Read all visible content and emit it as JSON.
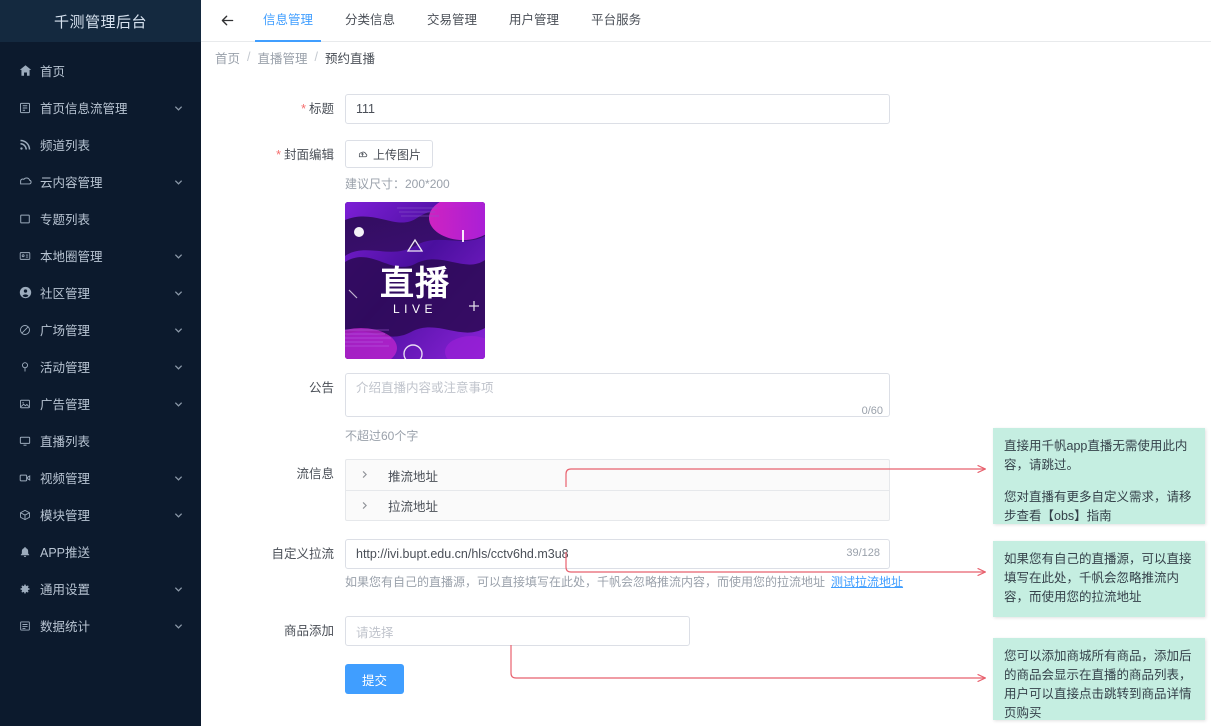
{
  "sidebar": {
    "brand": "千测管理后台",
    "items": [
      {
        "label": "首页",
        "icon": "home-icon",
        "expandable": false
      },
      {
        "label": "首页信息流管理",
        "icon": "feed-icon",
        "expandable": true
      },
      {
        "label": "频道列表",
        "icon": "rss-icon",
        "expandable": false
      },
      {
        "label": "云内容管理",
        "icon": "cloud-icon",
        "expandable": true
      },
      {
        "label": "专题列表",
        "icon": "square-icon",
        "expandable": false
      },
      {
        "label": "本地圈管理",
        "icon": "id-card-icon",
        "expandable": true
      },
      {
        "label": "社区管理",
        "icon": "user-circle-icon",
        "expandable": true
      },
      {
        "label": "广场管理",
        "icon": "ban-icon",
        "expandable": true
      },
      {
        "label": "活动管理",
        "icon": "pin-icon",
        "expandable": true
      },
      {
        "label": "广告管理",
        "icon": "image-icon",
        "expandable": true
      },
      {
        "label": "直播列表",
        "icon": "monitor-icon",
        "expandable": false
      },
      {
        "label": "视频管理",
        "icon": "video-camera-icon",
        "expandable": true
      },
      {
        "label": "模块管理",
        "icon": "cube-icon",
        "expandable": true
      },
      {
        "label": "APP推送",
        "icon": "bell-icon",
        "expandable": false
      },
      {
        "label": "通用设置",
        "icon": "gear-icon",
        "expandable": true
      },
      {
        "label": "数据统计",
        "icon": "chart-icon",
        "expandable": true
      }
    ]
  },
  "topbar": {
    "back_icon": "arrow-left-icon",
    "tabs": [
      {
        "label": "信息管理",
        "active": true
      },
      {
        "label": "分类信息",
        "active": false
      },
      {
        "label": "交易管理",
        "active": false
      },
      {
        "label": "用户管理",
        "active": false
      },
      {
        "label": "平台服务",
        "active": false
      }
    ]
  },
  "breadcrumb": {
    "items": [
      "首页",
      "直播管理",
      "预约直播"
    ],
    "separator": "/"
  },
  "form": {
    "title": {
      "label": "标题",
      "required": true,
      "value": "111"
    },
    "cover": {
      "label": "封面编辑",
      "required": true,
      "upload_button": "上传图片",
      "upload_icon": "cloud-upload-icon",
      "hint": "建议尺寸：200*200",
      "preview_text_main": "直播",
      "preview_text_sub": "LIVE"
    },
    "notice": {
      "label": "公告",
      "required": false,
      "value": "",
      "placeholder": "介绍直播内容或注意事项",
      "counter": "0/60",
      "hint": "不超过60个字"
    },
    "stream_info": {
      "label": "流信息",
      "required": false,
      "panels": [
        {
          "label": "推流地址",
          "expanded": false,
          "arrow_icon": "chevron-right-icon"
        },
        {
          "label": "拉流地址",
          "expanded": false,
          "arrow_icon": "chevron-right-icon"
        }
      ]
    },
    "custom_pull": {
      "label": "自定义拉流",
      "required": false,
      "value": "http://ivi.bupt.edu.cn/hls/cctv6hd.m3u8",
      "counter": "39/128",
      "hint": "如果您有自己的直播源，可以直接填写在此处，千帆会忽略推流内容，而使用您的拉流地址",
      "test_link": "测试拉流地址"
    },
    "product": {
      "label": "商品添加",
      "required": false,
      "placeholder": "请选择"
    },
    "submit_label": "提交"
  },
  "callouts": [
    {
      "id": "callout-stream-info",
      "paragraphs": [
        "直接用千帆app直播无需使用此内容，请跳过。",
        "您对直播有更多自定义需求，请移步查看【obs】指南"
      ]
    },
    {
      "id": "callout-custom-pull",
      "paragraphs": [
        "如果您有自己的直播源，可以直接填写在此处，千帆会忽略推流内容，而使用您的拉流地址"
      ]
    },
    {
      "id": "callout-product",
      "paragraphs": [
        "您可以添加商城所有商品，添加后的商品会显示在直播的商品列表，用户可以直接点击跳转到商品详情页购买"
      ]
    }
  ],
  "colors": {
    "sidebar_bg": "#0c1a2d",
    "sidebar_brand_bg": "#14293f",
    "accent": "#409eff",
    "required_star": "#f56c6c",
    "callout_bg": "#c5eee1",
    "annotation_line": "#e8616e"
  }
}
